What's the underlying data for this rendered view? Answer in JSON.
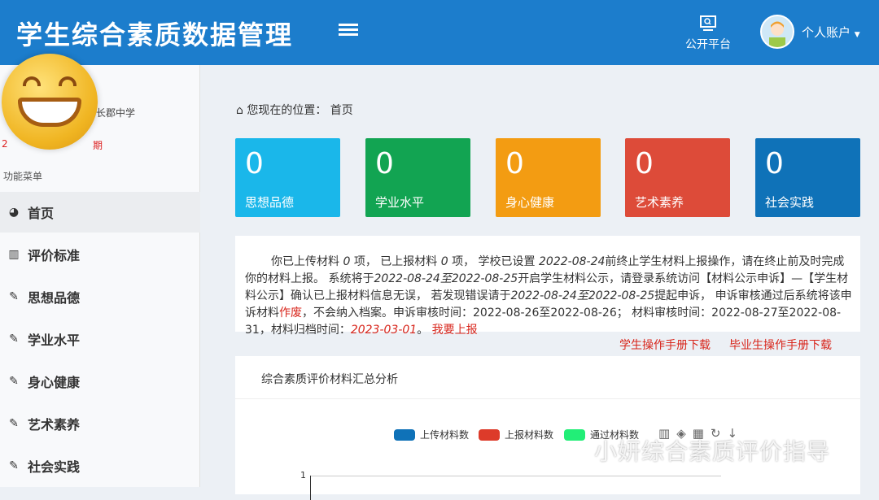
{
  "header": {
    "title": "学生综合素质数据管理",
    "public_platform": "公开平台",
    "account": "个人账户"
  },
  "sidebar": {
    "school": "长郡中学",
    "term_prefix": "2",
    "term_suffix": "期",
    "menu_title": "功能菜单",
    "items": [
      {
        "label": "首页",
        "icon": "dashboard-icon"
      },
      {
        "label": "评价标准",
        "icon": "map-icon"
      },
      {
        "label": "思想品德",
        "icon": "edit-icon"
      },
      {
        "label": "学业水平",
        "icon": "edit-icon"
      },
      {
        "label": "身心健康",
        "icon": "edit-icon"
      },
      {
        "label": "艺术素养",
        "icon": "edit-icon"
      },
      {
        "label": "社会实践",
        "icon": "edit-icon"
      }
    ]
  },
  "breadcrumb": {
    "prefix": "您现在的位置：",
    "current": "首页"
  },
  "cards": [
    {
      "value": "0",
      "label": "思想品德",
      "color": "#1ab7ea"
    },
    {
      "value": "0",
      "label": "学业水平",
      "color": "#12a452"
    },
    {
      "value": "0",
      "label": "身心健康",
      "color": "#f39c12"
    },
    {
      "value": "0",
      "label": "艺术素养",
      "color": "#dd4b39"
    },
    {
      "value": "0",
      "label": "社会实践",
      "color": "#0f72b8"
    }
  ],
  "notice": {
    "t1": "你已上传材料 ",
    "n1": "0",
    "t2": " 项， 已上报材料 ",
    "n2": "0",
    "t3": " 项， 学校已设置 ",
    "d1": "2022-08-24",
    "t4": "前终止学生材料上报操作，请在终止前及时完成你的材料上报。 系统将于",
    "d2": "2022-08-24至2022-08-25",
    "t5": "开启学生材料公示，请登录系统访问【材料公示申诉】—【学生材料公示】确认已上报材料信息无误， 若发现错误请于",
    "d3": "2022-08-24至2022-08-25",
    "t6": "提起申诉， 申诉审核通过后系统将该申诉材料",
    "void": "作废",
    "t7": "，不会纳入档案。申诉审核时间：2022-08-26至2022-08-26； 材料审核时间：2022-08-27至2022-08-31，材料归档时间：",
    "d4": "2023-03-01",
    "t8": "。 ",
    "report": "我要上报"
  },
  "downloads": {
    "student": "学生操作手册下载",
    "graduate": "毕业生操作手册下载"
  },
  "chart_data": {
    "type": "bar",
    "title": "综合素质评价材料汇总分析",
    "legend": [
      {
        "name": "上传材料数",
        "color": "#0f72b8"
      },
      {
        "name": "上报材料数",
        "color": "#dd3b2a"
      },
      {
        "name": "通过材料数",
        "color": "#22ee77"
      }
    ],
    "y_ticks": [
      "1"
    ],
    "series": []
  },
  "watermark": "小妍综合素质评价指导"
}
